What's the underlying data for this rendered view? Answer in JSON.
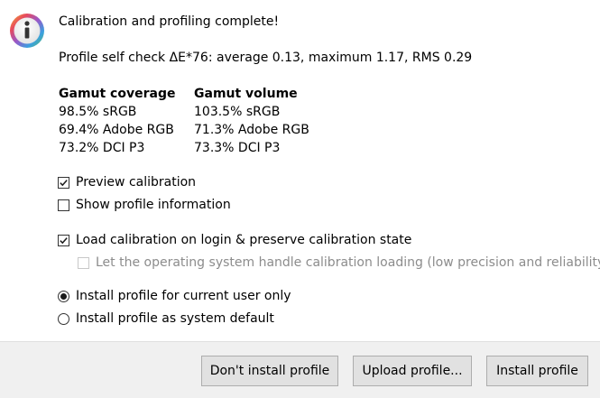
{
  "dialog": {
    "title": "Calibration and profiling complete!",
    "self_check": "Profile self check ΔE*76: average 0.13, maximum 1.17, RMS 0.29",
    "icon": "info-icon"
  },
  "gamut": {
    "coverage": {
      "header": "Gamut coverage",
      "rows": [
        "98.5% sRGB",
        "69.4% Adobe RGB",
        "73.2% DCI P3"
      ]
    },
    "volume": {
      "header": "Gamut volume",
      "rows": [
        "103.5% sRGB",
        "71.3% Adobe RGB",
        "73.3% DCI P3"
      ]
    }
  },
  "options": {
    "preview_calibration": {
      "label": "Preview calibration",
      "checked": true
    },
    "show_profile_info": {
      "label": "Show profile information",
      "checked": false
    },
    "load_calibration": {
      "label": "Load calibration on login & preserve calibration state",
      "checked": true
    },
    "os_handle": {
      "label": "Let the operating system handle calibration loading (low precision and reliability)",
      "checked": false,
      "disabled": true
    },
    "install_current_user": {
      "label": "Install profile for current user only",
      "selected": true
    },
    "install_system_default": {
      "label": "Install profile as system default",
      "selected": false
    }
  },
  "buttons": {
    "dont_install": "Don't install profile",
    "upload": "Upload profile...",
    "install": "Install profile"
  }
}
